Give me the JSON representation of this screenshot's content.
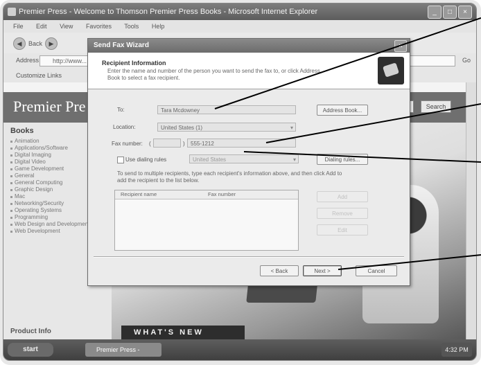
{
  "browser": {
    "title": "Premier Press - Welcome to Thomson Premier Press Books - Microsoft Internet Explorer",
    "menu": [
      "File",
      "Edit",
      "View",
      "Favorites",
      "Tools",
      "Help"
    ],
    "back_label": "Back",
    "address_label": "Address",
    "address_value": "http://www...",
    "go_label": "Go",
    "links_text": "Customize Links"
  },
  "page": {
    "banner_title": "Premier Pre",
    "search_button": "Search",
    "nav_heading": "Books",
    "nav_items": [
      "Animation",
      "Applications/Software",
      "Digital Imaging",
      "Digital Video",
      "Game Development",
      "General",
      "General Computing",
      "Graphic Design",
      "Mac",
      "Networking/Security",
      "Operating Systems",
      "Programming",
      "Web Design and Development",
      "Web Development"
    ],
    "nav_footer": "Product Info",
    "whats_new": "WHAT'S NEW"
  },
  "taskbar": {
    "start_label": "start",
    "task_label": "Premier Press - Welco...",
    "tray_text": "4:32 PM"
  },
  "dialog": {
    "title": "Send Fax Wizard",
    "close_glyph": "×",
    "header_title": "Recipient Information",
    "header_desc": "Enter the name and number of the person you want to send the fax to, or click Address Book to select a fax recipient.",
    "to_label": "To:",
    "to_value": "Tara Mcdowney",
    "location_label": "Location:",
    "location_value": "United States (1)",
    "fax_label": "Fax number:",
    "fax_area_open": "(",
    "fax_area_value": "",
    "fax_area_close": ")",
    "fax_number_value": "555-1212",
    "dialing_rules_label": "Use dialing rules",
    "dialing_rules_value": "United States",
    "address_book_button": "Address Book...",
    "dialing_rules_button": "Dialing rules...",
    "instructions": "To send to multiple recipients, type each recipient's information above, and then click Add to add the recipient to the list below.",
    "list_columns": [
      "Recipient name",
      "Fax number"
    ],
    "side_buttons": [
      "Add",
      "Remove",
      "Edit"
    ],
    "back_button": "< Back",
    "next_button": "Next >",
    "cancel_button": "Cancel"
  },
  "colors": {
    "dialog_title": "#7a7a7a",
    "banner": "#6f6f6f",
    "callout_line": "#000000"
  }
}
